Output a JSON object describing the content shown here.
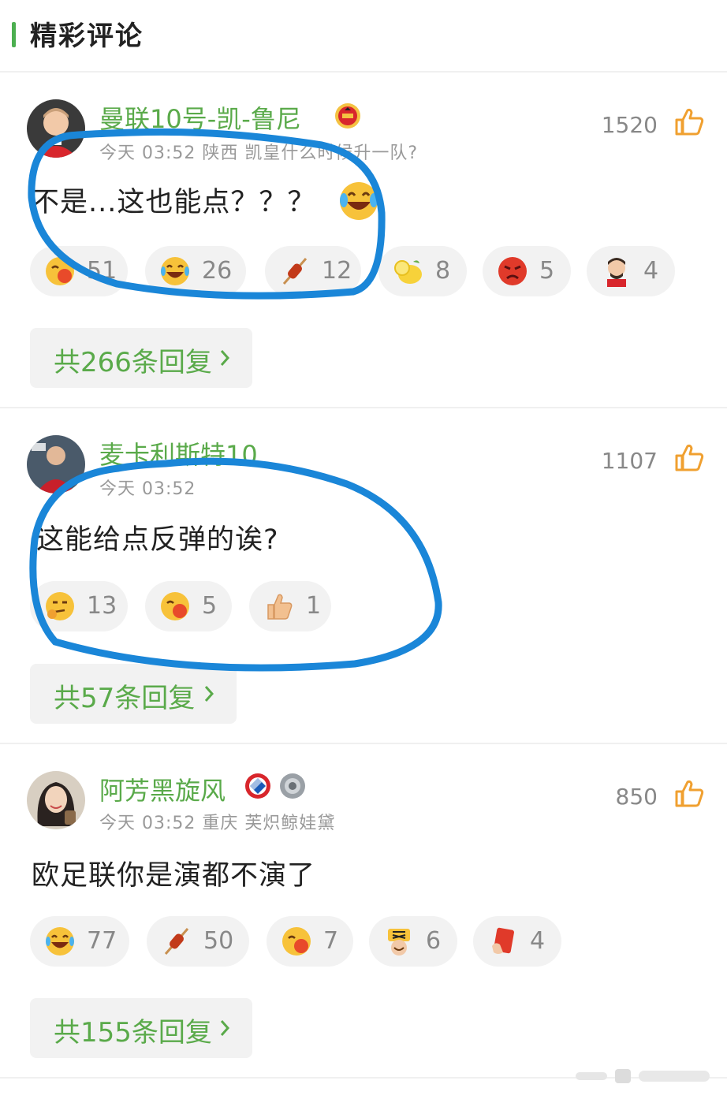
{
  "header": {
    "title": "精彩评论"
  },
  "colors": {
    "accent_green": "#5aaa4a",
    "annotation_blue": "#1a86d8",
    "like_orange": "#f0a030"
  },
  "comments": [
    {
      "username": "曼联10号-凯-鲁尼",
      "meta": "今天 03:52 陕西 凯皇什么时候升一队?",
      "text": "不是...这也能点？？？",
      "likes": "1520",
      "reactions": [
        {
          "icon": "cover-face-emoji",
          "count": "51"
        },
        {
          "icon": "laugh-cry-emoji",
          "count": "26"
        },
        {
          "icon": "skewer-emoji",
          "count": "12"
        },
        {
          "icon": "lemon-emoji",
          "count": "8"
        },
        {
          "icon": "angry-face-emoji",
          "count": "5"
        },
        {
          "icon": "man-sticker-emoji",
          "count": "4"
        }
      ],
      "replies": "共266条回复"
    },
    {
      "username": "麦卡利斯特10",
      "meta": "今天 03:52",
      "text": "这能给点反弹的诶?",
      "likes": "1107",
      "reactions": [
        {
          "icon": "thinking-face-emoji",
          "count": "13"
        },
        {
          "icon": "cover-face-emoji",
          "count": "5"
        },
        {
          "icon": "thumbs-up-emoji",
          "count": "1"
        }
      ],
      "replies": "共57条回复"
    },
    {
      "username": "阿芳黑旋风",
      "meta": "今天 03:52 重庆 芙炽鲸娃黛",
      "text": "欧足联你是演都不演了",
      "likes": "850",
      "reactions": [
        {
          "icon": "laugh-cry-emoji",
          "count": "77"
        },
        {
          "icon": "skewer-emoji",
          "count": "50"
        },
        {
          "icon": "cover-face-emoji",
          "count": "7"
        },
        {
          "icon": "shuang-sticker-emoji",
          "count": "6"
        },
        {
          "icon": "red-card-emoji",
          "count": "4"
        }
      ],
      "replies": "共155条回复"
    }
  ]
}
